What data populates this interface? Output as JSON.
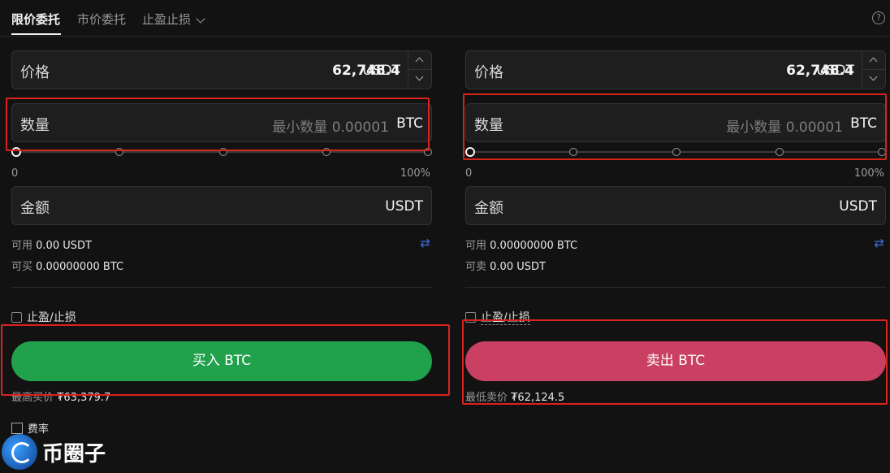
{
  "tabs": {
    "limit": "限价委托",
    "market": "市价委托",
    "tpsl": "止盈止损",
    "help": "?"
  },
  "buy": {
    "price_label": "价格",
    "price_value": "62,748.4",
    "price_unit": "USDT",
    "qty_label": "数量",
    "qty_placeholder": "最小数量 0.00001",
    "qty_unit": "BTC",
    "slider_min": "0",
    "slider_max": "100%",
    "amount_label": "金额",
    "amount_unit": "USDT",
    "avail_label": "可用",
    "avail_value": "0.00 USDT",
    "can_label": "可买",
    "can_value": "0.00000000 BTC",
    "tpsl_label": "止盈/止损",
    "button": "买入 BTC",
    "best_label": "最高买价",
    "best_value": "₮63,379.7"
  },
  "sell": {
    "price_label": "价格",
    "price_value": "62,748.4",
    "price_unit": "USDT",
    "qty_label": "数量",
    "qty_placeholder": "最小数量 0.00001",
    "qty_unit": "BTC",
    "slider_min": "0",
    "slider_max": "100%",
    "amount_label": "金额",
    "amount_unit": "USDT",
    "avail_label": "可用",
    "avail_value": "0.00000000 BTC",
    "can_label": "可卖",
    "can_value": "0.00 USDT",
    "tpsl_label": "止盈/止损",
    "button": "卖出 BTC",
    "best_label": "最低卖价",
    "best_value": "₮62,124.5"
  },
  "fee_label": "费率",
  "watermark": "币圈子",
  "colors": {
    "background": "#121212",
    "buy": "#22a14d",
    "sell": "#c94062",
    "highlight": "#d9231d",
    "swap": "#3d6fe0"
  }
}
